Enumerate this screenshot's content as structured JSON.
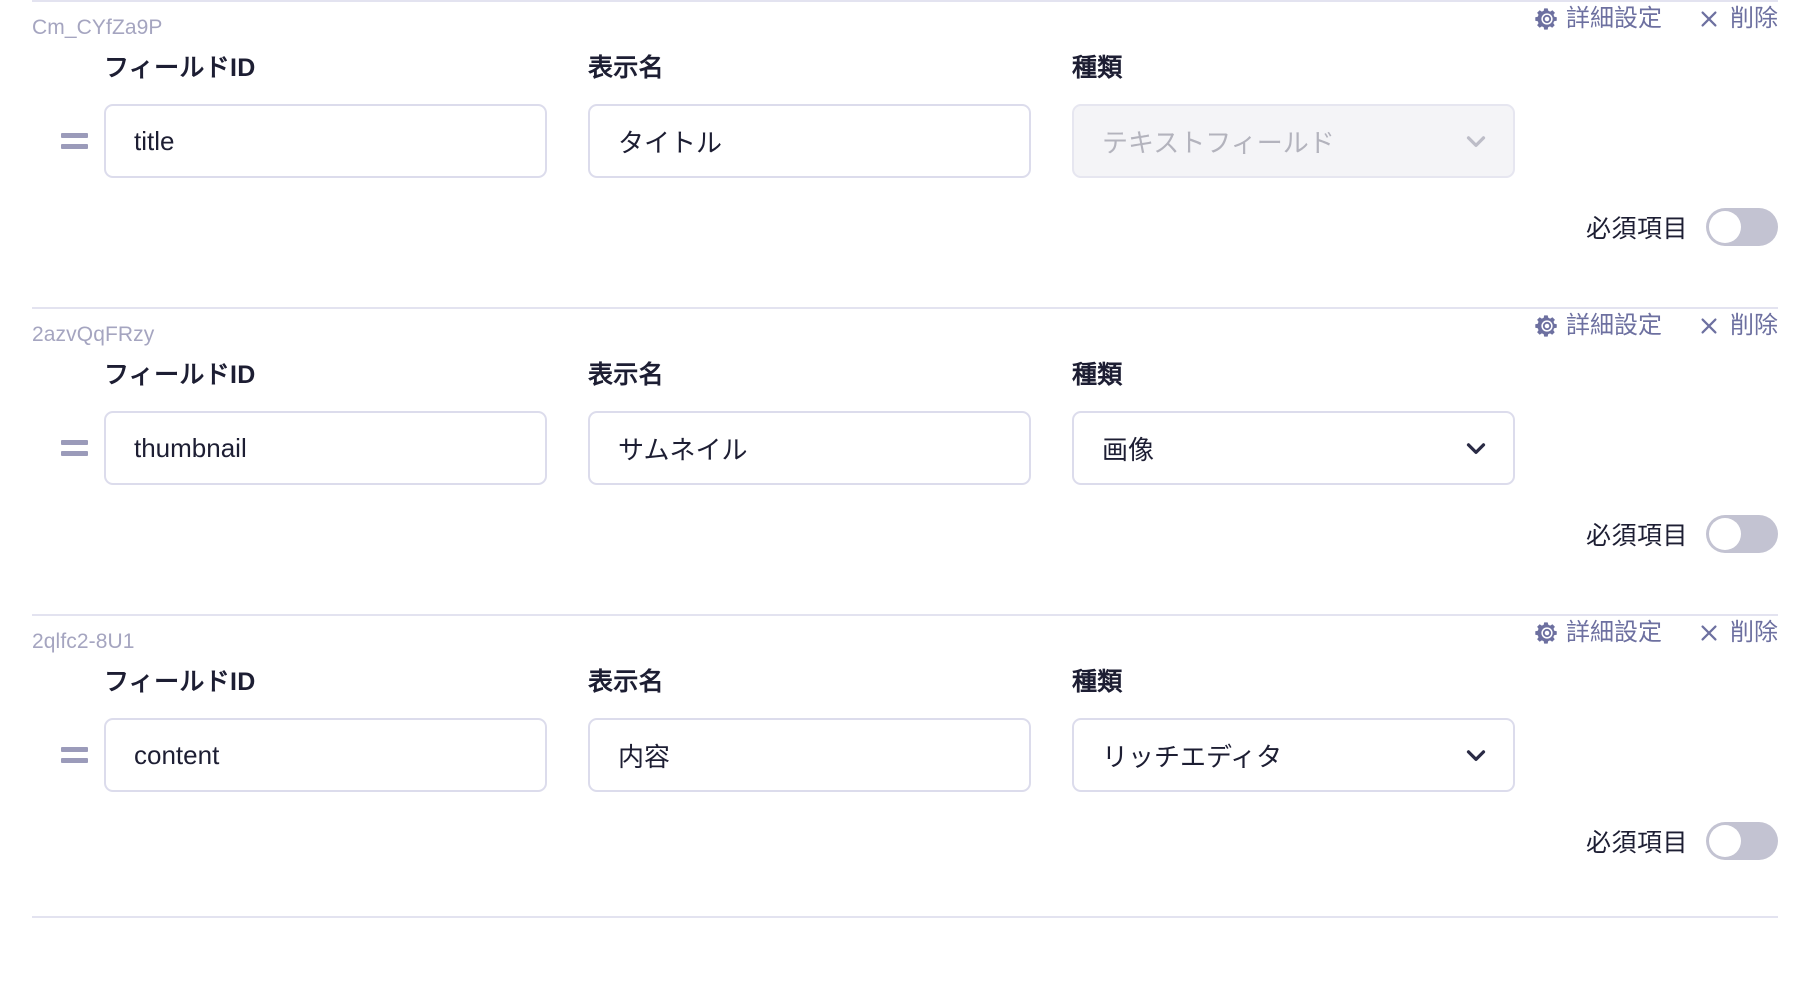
{
  "labels": {
    "field_id": "フィールドID",
    "display_name": "表示名",
    "kind": "種類",
    "required": "必須項目",
    "settings": "詳細設定",
    "delete": "削除"
  },
  "colors": {
    "accent": "#6d70a0",
    "divider": "#e3e3f0",
    "input_border": "#dcdcec",
    "text": "#1d1e33",
    "uid": "#a5a5c0",
    "disabled_bg": "#f4f4f7",
    "disabled_text": "#b3b3bd",
    "toggle_off": "#c3c3d2"
  },
  "icons": {
    "gear": "gear-icon",
    "close": "close-icon",
    "chevron_down": "chevron-down-icon",
    "drag": "drag-handle-icon"
  },
  "fields": [
    {
      "uid": "Cm_CYfZa9P",
      "field_id_value": "title",
      "field_id_placeholder": "",
      "display_name_value": "タイトル",
      "display_name_placeholder": "",
      "kind_value": "テキストフィールド",
      "kind_disabled": true,
      "required_on": false
    },
    {
      "uid": "2azvQqFRzy",
      "field_id_value": "thumbnail",
      "field_id_placeholder": "",
      "display_name_value": "サムネイル",
      "display_name_placeholder": "",
      "kind_value": "画像",
      "kind_disabled": false,
      "required_on": false
    },
    {
      "uid": "2qlfc2-8U1",
      "field_id_value": "content",
      "field_id_placeholder": "",
      "display_name_value": "内容",
      "display_name_placeholder": "",
      "kind_value": "リッチエディタ",
      "kind_disabled": false,
      "required_on": false
    }
  ]
}
